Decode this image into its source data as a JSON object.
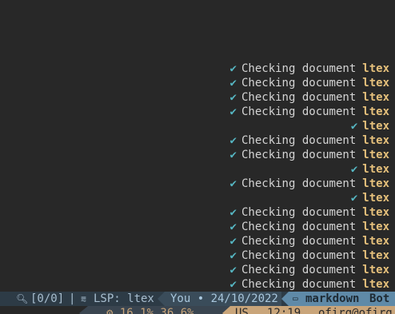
{
  "notifications": [
    {
      "message": "Checking document",
      "source": "ltex"
    },
    {
      "message": "Checking document",
      "source": "ltex"
    },
    {
      "message": "Checking document",
      "source": "ltex"
    },
    {
      "message": "Checking document",
      "source": "ltex"
    },
    {
      "message": "",
      "source": "ltex"
    },
    {
      "message": "Checking document",
      "source": "ltex"
    },
    {
      "message": "Checking document",
      "source": "ltex"
    },
    {
      "message": "",
      "source": "ltex"
    },
    {
      "message": "Checking document",
      "source": "ltex"
    },
    {
      "message": "",
      "source": "ltex"
    },
    {
      "message": "Checking document",
      "source": "ltex"
    },
    {
      "message": "Checking document",
      "source": "ltex"
    },
    {
      "message": "Checking document",
      "source": "ltex"
    },
    {
      "message": "Checking document",
      "source": "ltex"
    },
    {
      "message": "Checking document",
      "source": "ltex"
    },
    {
      "message": "Checking document",
      "source": "ltex"
    }
  ],
  "statusline": {
    "search_count": "[0/0]",
    "separator": "|",
    "lsp": "LSP: ltex",
    "blame": "You • 24/10/2022",
    "filetype": "markdown",
    "position": "Bot"
  },
  "statusline2": {
    "usage": "16.1% 36.6%",
    "lang": "US",
    "time": "12:19",
    "user": "ofirg@ofirg"
  },
  "colors": {
    "background": "#282828",
    "check": "#56b6c2",
    "source": "#e5c07b",
    "statusline_bg": "#2d3b46",
    "filetype_bg": "#5f8aa8",
    "clock_bg": "#c9a57a"
  },
  "icons": {
    "check": "check-icon",
    "search": "search-icon",
    "lsp": "lsp-icon",
    "filetype": "markdown-icon",
    "usage": "cpu-icon"
  }
}
